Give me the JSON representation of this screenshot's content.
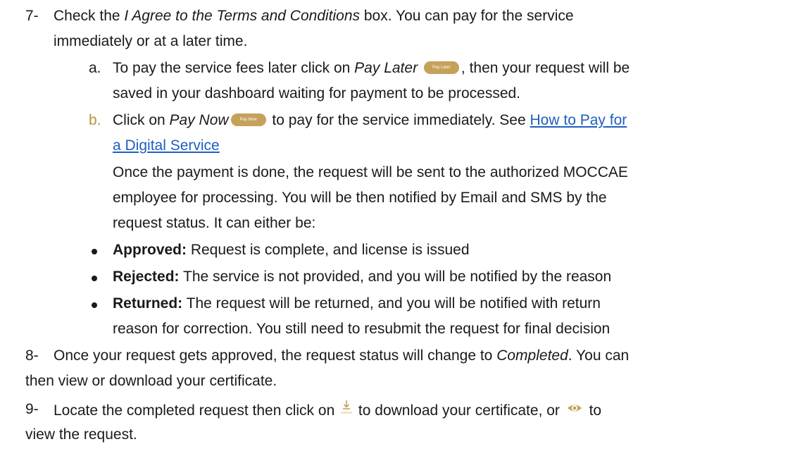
{
  "step7": {
    "number": "7-",
    "line1_pre": "Check the ",
    "line1_em": "I Agree to the Terms and Conditions",
    "line1_post": " box. You can pay for the service",
    "line2": "immediately or at a later time."
  },
  "sub_a": {
    "letter": "a.",
    "line1_pre": "To pay the service fees later click on ",
    "line1_em": "Pay Later",
    "pill_label": "Pay Later",
    "line1_post": ", then your request will be",
    "line2": "saved in your dashboard waiting for payment to be processed."
  },
  "sub_b": {
    "letter": "b.",
    "line1_pre": "Click on ",
    "line1_em": "Pay Now",
    "pill_label": "Pay Now",
    "line1_post": " to pay for the service immediately. See ",
    "link_part1": "How to Pay for",
    "link_part2": "a Digital Service",
    "para1": "Once the payment is done, the request will be sent to the authorized MOCCAE",
    "para2": "employee for processing. You will be then notified by Email and SMS by the",
    "para3": "request status. It can either be:"
  },
  "statuses": [
    {
      "label": "Approved:",
      "text": " Request is complete, and license is issued"
    },
    {
      "label": "Rejected:",
      "text": " The service is not provided, and you will be notified by the reason"
    },
    {
      "label": "Returned:",
      "text": " The request will be returned, and you will be notified with return",
      "text2": "reason for correction. You still need to resubmit the request for final decision"
    }
  ],
  "step8": {
    "number": "8-",
    "line1_pre": "Once your request gets approved, the request status will change to ",
    "line1_em": "Completed",
    "line1_post": ". You can",
    "line2": "then view or download your certificate."
  },
  "step9": {
    "number": "9-",
    "line1_pre": "Locate the completed request then click on ",
    "download_icon_label": "Download",
    "line1_mid": " to download your certificate, or ",
    "line1_post": " to",
    "line2": "view the request."
  },
  "colors": {
    "gold": "#c5a15a",
    "gold_text": "#b8913a",
    "link": "#1f5fbf",
    "text": "#1a1a1a"
  },
  "icons": {
    "download": "download-icon",
    "view": "eye-icon"
  }
}
